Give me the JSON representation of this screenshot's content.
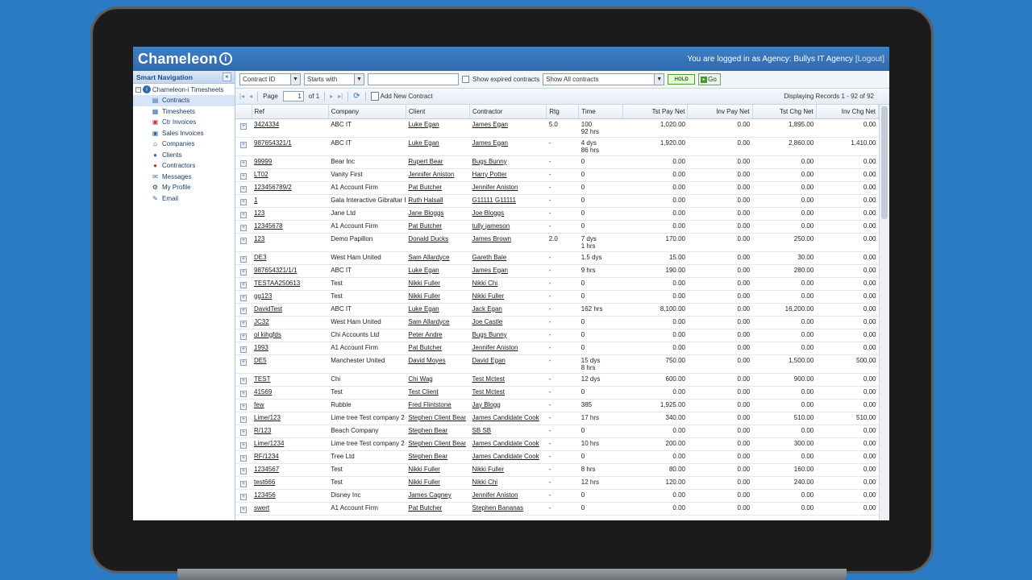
{
  "app": {
    "logo_text": "Chameleon",
    "logo_mark": "i",
    "login_prefix": "You are logged in as Agency:",
    "agency_name": "Bullys IT Agency",
    "logout_label": "[Logout]"
  },
  "sidebar": {
    "title": "Smart Navigation",
    "collapse_glyph": "«",
    "root_label": "Chameleon-i Timesheets",
    "items": [
      {
        "label": "Contracts",
        "icon": "contracts-icon"
      },
      {
        "label": "Timesheets",
        "icon": "timesheets-icon"
      },
      {
        "label": "Ctr Invoices",
        "icon": "ctr-invoices-icon"
      },
      {
        "label": "Sales Invoices",
        "icon": "sales-invoices-icon"
      },
      {
        "label": "Companies",
        "icon": "companies-icon"
      },
      {
        "label": "Clients",
        "icon": "clients-icon"
      },
      {
        "label": "Contractors",
        "icon": "contractors-icon"
      },
      {
        "label": "Messages",
        "icon": "messages-icon"
      },
      {
        "label": "My Profile",
        "icon": "profile-icon"
      },
      {
        "label": "Email",
        "icon": "email-icon"
      }
    ]
  },
  "filter": {
    "field_select": "Contract ID",
    "operator_select": "Starts with",
    "search_value": "",
    "show_expired_label": "Show expired contracts",
    "scope_select": "Show All contracts",
    "hold_label": "HOLD",
    "go_label": "Go"
  },
  "pager": {
    "page_label": "Page",
    "page_value": "1",
    "of_label": "of 1",
    "add_label": "Add New Contract",
    "records_text": "Displaying Records 1 - 92 of 92"
  },
  "columns": [
    "Ref",
    "Company",
    "Client",
    "Contractor",
    "Rtg",
    "Time",
    "Tst Pay Net",
    "Inv Pay Net",
    "Tst Chg Net",
    "Inv Chg Net"
  ],
  "rows": [
    {
      "ref": "3424334",
      "company": "ABC IT",
      "client": "Luke Egan",
      "contractor": "James Egan",
      "rtg": "5.0",
      "time": "100",
      "time2": "92 hrs",
      "tst_pay": "1,020.00",
      "inv_pay": "0.00",
      "tst_chg": "1,895.00",
      "inv_chg": "0.00"
    },
    {
      "ref": "987654321/1",
      "company": "ABC IT",
      "client": "Luke Egan",
      "contractor": "James Egan",
      "rtg": "-",
      "time": "4 dys",
      "time2": "86 hrs",
      "tst_pay": "1,920.00",
      "inv_pay": "0.00",
      "tst_chg": "2,860.00",
      "inv_chg": "1,410.00"
    },
    {
      "ref": "99999",
      "company": "Bear Inc",
      "client": "Rupert Bear",
      "contractor": "Bugs Bunny",
      "rtg": "-",
      "time": "0",
      "time2": "",
      "tst_pay": "0.00",
      "inv_pay": "0.00",
      "tst_chg": "0.00",
      "inv_chg": "0.00"
    },
    {
      "ref": "LT02",
      "company": "Vanity First",
      "client": "Jennifer Aniston",
      "contractor": "Harry Potter",
      "rtg": "-",
      "time": "0",
      "time2": "",
      "tst_pay": "0.00",
      "inv_pay": "0.00",
      "tst_chg": "0.00",
      "inv_chg": "0.00"
    },
    {
      "ref": "123456789/2",
      "company": "A1 Account Firm",
      "client": "Pat Butcher",
      "contractor": "Jennifer Aniston",
      "rtg": "-",
      "time": "0",
      "time2": "",
      "tst_pay": "0.00",
      "inv_pay": "0.00",
      "tst_chg": "0.00",
      "inv_chg": "0.00"
    },
    {
      "ref": "1",
      "company": "Gala Interactive Gibraltar Limited",
      "client": "Ruth Halsall",
      "contractor": "G11111 G11111",
      "rtg": "-",
      "time": "0",
      "time2": "",
      "tst_pay": "0.00",
      "inv_pay": "0.00",
      "tst_chg": "0.00",
      "inv_chg": "0.00"
    },
    {
      "ref": "123",
      "company": "Jane Ltd",
      "client": "Jane Bloggs",
      "contractor": "Joe Bloggs",
      "rtg": "-",
      "time": "0",
      "time2": "",
      "tst_pay": "0.00",
      "inv_pay": "0.00",
      "tst_chg": "0.00",
      "inv_chg": "0.00"
    },
    {
      "ref": "12345678",
      "company": "A1 Account Firm",
      "client": "Pat Butcher",
      "contractor": "tully jameson",
      "rtg": "-",
      "time": "0",
      "time2": "",
      "tst_pay": "0.00",
      "inv_pay": "0.00",
      "tst_chg": "0.00",
      "inv_chg": "0.00"
    },
    {
      "ref": "123",
      "company": "Demo Papillon",
      "client": "Donald Ducks",
      "contractor": "James Brown",
      "rtg": "2.0",
      "time": "7 dys",
      "time2": "1 hrs",
      "tst_pay": "170.00",
      "inv_pay": "0.00",
      "tst_chg": "250.00",
      "inv_chg": "0.00"
    },
    {
      "ref": "DE3",
      "company": "West Ham United",
      "client": "Sam Allardyce",
      "contractor": "Gareth Bale",
      "rtg": "-",
      "time": "1.5 dys",
      "time2": "",
      "tst_pay": "15.00",
      "inv_pay": "0.00",
      "tst_chg": "30.00",
      "inv_chg": "0.00"
    },
    {
      "ref": "987654321/1/1",
      "company": "ABC IT",
      "client": "Luke Egan",
      "contractor": "James Egan",
      "rtg": "-",
      "time": "9 hrs",
      "time2": "",
      "tst_pay": "190.00",
      "inv_pay": "0.00",
      "tst_chg": "280.00",
      "inv_chg": "0.00"
    },
    {
      "ref": "TESTAA250613",
      "company": "Test",
      "client": "Nikki Fuller",
      "contractor": "Nikki Chi",
      "rtg": "-",
      "time": "0",
      "time2": "",
      "tst_pay": "0.00",
      "inv_pay": "0.00",
      "tst_chg": "0.00",
      "inv_chg": "0.00"
    },
    {
      "ref": "gg123",
      "company": "Test",
      "client": "Nikki Fuller",
      "contractor": "Nikki Fuller",
      "rtg": "-",
      "time": "0",
      "time2": "",
      "tst_pay": "0.00",
      "inv_pay": "0.00",
      "tst_chg": "0.00",
      "inv_chg": "0.00"
    },
    {
      "ref": "DavidTest",
      "company": "ABC IT",
      "client": "Luke Egan",
      "contractor": "Jack Egan",
      "rtg": "-",
      "time": "162 hrs",
      "time2": "",
      "tst_pay": "8,100.00",
      "inv_pay": "0.00",
      "tst_chg": "16,200.00",
      "inv_chg": "0.00"
    },
    {
      "ref": "JC32",
      "company": "West Ham United",
      "client": "Sam Allardyce",
      "contractor": "Joe Castle",
      "rtg": "-",
      "time": "0",
      "time2": "",
      "tst_pay": "0.00",
      "inv_pay": "0.00",
      "tst_chg": "0.00",
      "inv_chg": "0.00"
    },
    {
      "ref": "ol kihgfds",
      "company": "Chi Accounts Ltd",
      "client": "Peter Andre",
      "contractor": "Bugs Bunny",
      "rtg": "-",
      "time": "0",
      "time2": "",
      "tst_pay": "0.00",
      "inv_pay": "0.00",
      "tst_chg": "0.00",
      "inv_chg": "0.00"
    },
    {
      "ref": "1993",
      "company": "A1 Account Firm",
      "client": "Pat Butcher",
      "contractor": "Jennifer Aniston",
      "rtg": "-",
      "time": "0",
      "time2": "",
      "tst_pay": "0.00",
      "inv_pay": "0.00",
      "tst_chg": "0.00",
      "inv_chg": "0.00"
    },
    {
      "ref": "DE5",
      "company": "Manchester United",
      "client": "David Moyes",
      "contractor": "David Egan",
      "rtg": "-",
      "time": "15 dys",
      "time2": "8 hrs",
      "tst_pay": "750.00",
      "inv_pay": "0.00",
      "tst_chg": "1,500.00",
      "inv_chg": "500.00"
    },
    {
      "ref": "TEST",
      "company": "Chi",
      "client": "Chi Wag",
      "contractor": "Test Mctest",
      "rtg": "-",
      "time": "12 dys",
      "time2": "",
      "tst_pay": "600.00",
      "inv_pay": "0.00",
      "tst_chg": "900.00",
      "inv_chg": "0.00"
    },
    {
      "ref": "41569",
      "company": "Test",
      "client": "Test Client",
      "contractor": "Test Mctest",
      "rtg": "-",
      "time": "0",
      "time2": "",
      "tst_pay": "0.00",
      "inv_pay": "0.00",
      "tst_chg": "0.00",
      "inv_chg": "0.00"
    },
    {
      "ref": "few",
      "company": "Rubble",
      "client": "Fred Flintstone",
      "contractor": "Jay Blogg",
      "rtg": "-",
      "time": "385",
      "time2": "",
      "tst_pay": "1,925.00",
      "inv_pay": "0.00",
      "tst_chg": "0.00",
      "inv_chg": "0.00"
    },
    {
      "ref": "Lime/123",
      "company": "Lime tree Test company 2",
      "client": "Stephen Client Bear",
      "contractor": "James Candidate Cook",
      "rtg": "-",
      "time": "17 hrs",
      "time2": "",
      "tst_pay": "340.00",
      "inv_pay": "0.00",
      "tst_chg": "510.00",
      "inv_chg": "510.00"
    },
    {
      "ref": "R/123",
      "company": "Beach Company",
      "client": "Stephen Bear",
      "contractor": "SB SB",
      "rtg": "-",
      "time": "0",
      "time2": "",
      "tst_pay": "0.00",
      "inv_pay": "0.00",
      "tst_chg": "0.00",
      "inv_chg": "0.00"
    },
    {
      "ref": "Lime/1234",
      "company": "Lime tree Test company 2",
      "client": "Stephen Client Bear",
      "contractor": "James Candidate Cook",
      "rtg": "-",
      "time": "10 hrs",
      "time2": "",
      "tst_pay": "200.00",
      "inv_pay": "0.00",
      "tst_chg": "300.00",
      "inv_chg": "0.00"
    },
    {
      "ref": "RF/1234",
      "company": "Tree Ltd",
      "client": "Stephen Bear",
      "contractor": "James Candidate Cook",
      "rtg": "-",
      "time": "0",
      "time2": "",
      "tst_pay": "0.00",
      "inv_pay": "0.00",
      "tst_chg": "0.00",
      "inv_chg": "0.00"
    },
    {
      "ref": "1234567",
      "company": "Test",
      "client": "Nikki Fuller",
      "contractor": "Nikki Fuller",
      "rtg": "-",
      "time": "8 hrs",
      "time2": "",
      "tst_pay": "80.00",
      "inv_pay": "0.00",
      "tst_chg": "160.00",
      "inv_chg": "0.00"
    },
    {
      "ref": "test666",
      "company": "Test",
      "client": "Nikki Fuller",
      "contractor": "Nikki Chi",
      "rtg": "-",
      "time": "12 hrs",
      "time2": "",
      "tst_pay": "120.00",
      "inv_pay": "0.00",
      "tst_chg": "240.00",
      "inv_chg": "0.00"
    },
    {
      "ref": "123456",
      "company": "Disney Inc",
      "client": "James Cagney",
      "contractor": "Jennifer Aniston",
      "rtg": "-",
      "time": "0",
      "time2": "",
      "tst_pay": "0.00",
      "inv_pay": "0.00",
      "tst_chg": "0.00",
      "inv_chg": "0.00"
    },
    {
      "ref": "swert",
      "company": "A1 Account Firm",
      "client": "Pat Butcher",
      "contractor": "Stephen Bananas",
      "rtg": "-",
      "time": "0",
      "time2": "",
      "tst_pay": "0.00",
      "inv_pay": "0.00",
      "tst_chg": "0.00",
      "inv_chg": "0.00"
    }
  ]
}
